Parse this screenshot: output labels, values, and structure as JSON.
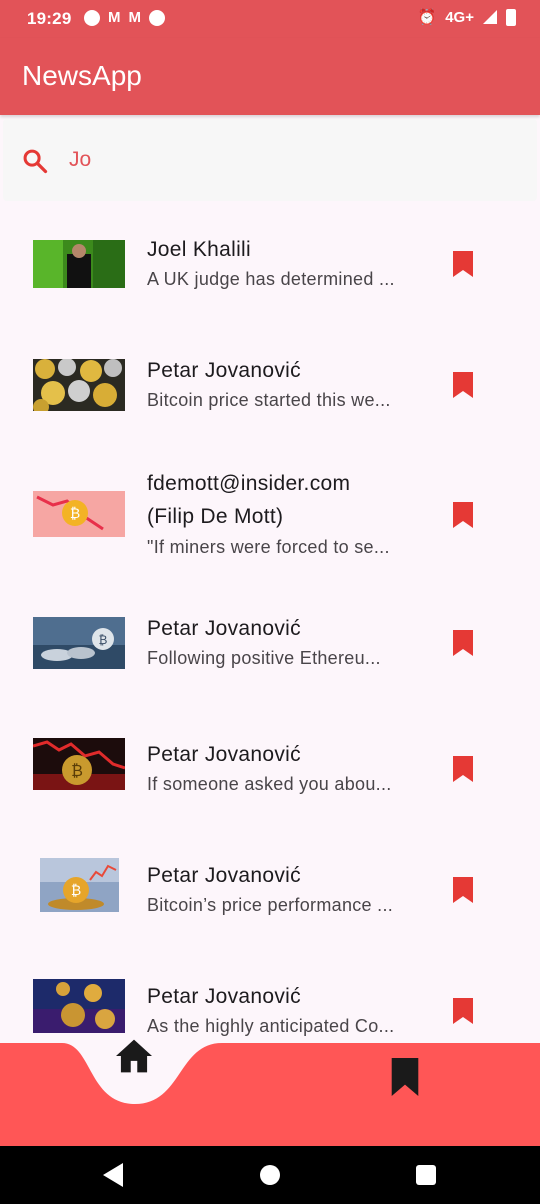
{
  "status": {
    "time": "19:29",
    "network": "4G+"
  },
  "app": {
    "title": "NewsApp"
  },
  "search": {
    "value": "Jo"
  },
  "articles": [
    {
      "author": "Joel Khalili",
      "description": "A UK judge has determined ..."
    },
    {
      "author": "Petar Jovanović",
      "description": "Bitcoin price started this we..."
    },
    {
      "author": "fdemott@insider.com (Filip De Mott)",
      "author_line1": "fdemott@insider.com",
      "author_line2": "(Filip De Mott)",
      "description": "\"If miners were forced to se..."
    },
    {
      "author": "Petar Jovanović",
      "description": "Following positive Ethereu..."
    },
    {
      "author": "Petar Jovanović",
      "description": "If someone asked you abou..."
    },
    {
      "author": "Petar Jovanović",
      "description": "Bitcoin’s price performance ..."
    },
    {
      "author": "Petar Jovanović",
      "description": "As the highly anticipated Co..."
    }
  ],
  "colors": {
    "app_bar": "#e25358",
    "accent": "#e53935",
    "bottom_nav": "#ff5656"
  },
  "icons": {
    "search": "search-icon",
    "bookmark": "bookmark-icon",
    "home": "home-icon",
    "saved": "bookmark-nav-icon"
  }
}
